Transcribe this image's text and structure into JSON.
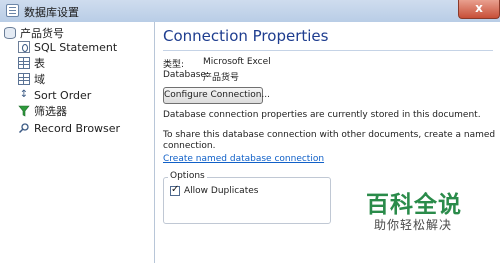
{
  "window": {
    "title": "数据库设置",
    "close_label": "x"
  },
  "sidebar": {
    "items": [
      {
        "label": "产品货号",
        "icon": "database-icon"
      },
      {
        "label": "SQL Statement",
        "icon": "sql-icon"
      },
      {
        "label": "表",
        "icon": "table-icon"
      },
      {
        "label": "域",
        "icon": "field-icon"
      },
      {
        "label": "Sort Order",
        "icon": "sort-icon"
      },
      {
        "label": "筛选器",
        "icon": "filter-icon"
      },
      {
        "label": "Record Browser",
        "icon": "browser-icon"
      }
    ]
  },
  "main": {
    "title": "Connection Properties",
    "type_label": "类型:",
    "type_value": "Microsoft Excel",
    "database_label": "Database:",
    "database_value": "产品货号",
    "configure_button": "Configure Connection...",
    "stored_text": "Database connection properties are currently stored in this document.",
    "share_text_1": "To share this database connection with other documents, create a named",
    "share_text_2": "connection.",
    "create_link": "Create named database connection",
    "options_legend": "Options",
    "allow_duplicates": "Allow Duplicates",
    "allow_duplicates_checked": true
  },
  "watermark": {
    "title": "百科全说",
    "subtitle": "助你轻松解决"
  }
}
